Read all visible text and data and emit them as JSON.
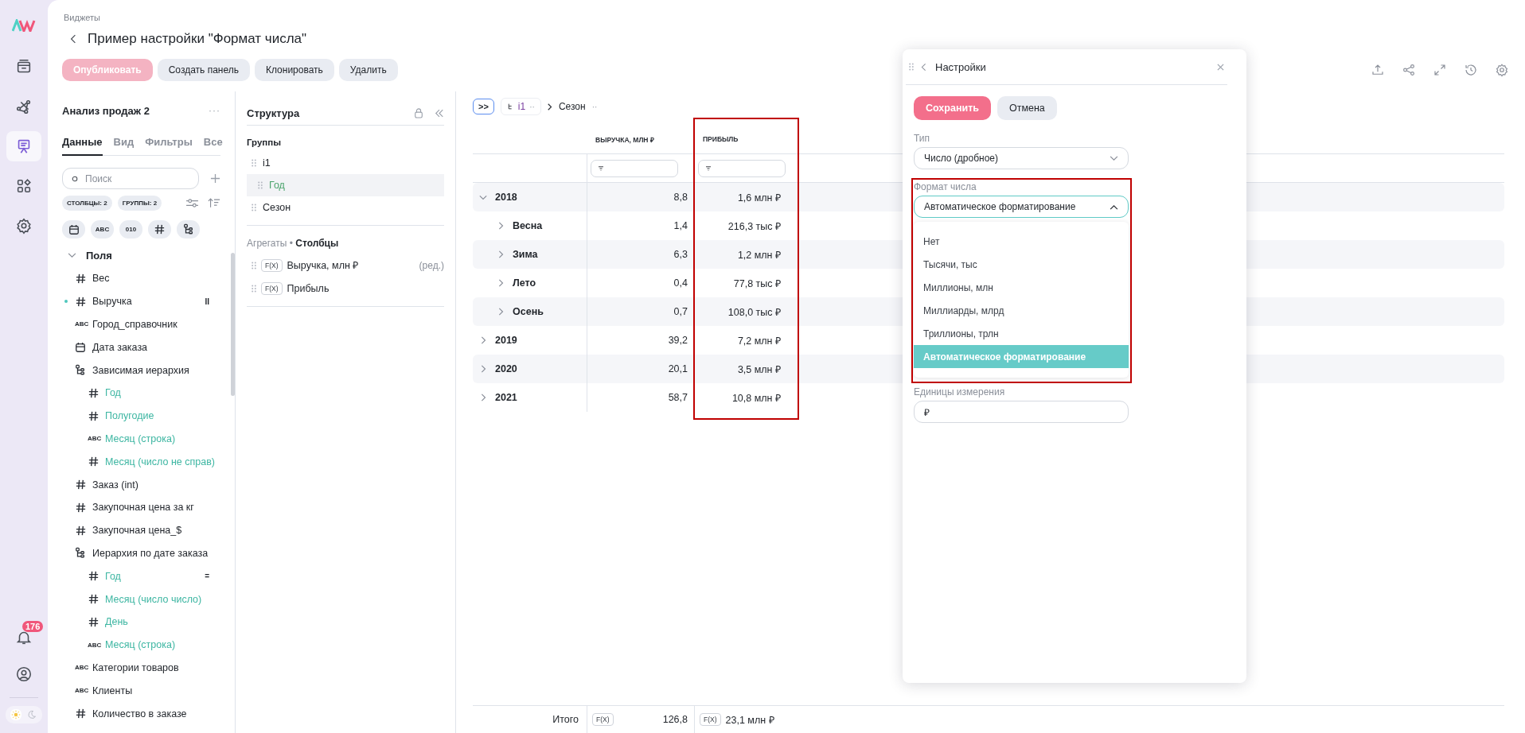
{
  "nav": {
    "items": [
      {
        "kind": "inbox",
        "selected": false
      },
      {
        "kind": "graph",
        "selected": false
      },
      {
        "kind": "presentation",
        "selected": true
      },
      {
        "kind": "grid",
        "selected": false
      },
      {
        "kind": "gear",
        "selected": false
      }
    ],
    "notifications": {
      "badge": "176"
    },
    "theme_options": [
      {
        "kind": "light",
        "selected": true
      },
      {
        "kind": "dark",
        "selected": false
      }
    ]
  },
  "header": {
    "breadcrumb": "Виджеты",
    "title": "Пример настройки \"Формат числа\"",
    "buttons": [
      {
        "label": "Опубликовать",
        "disabled": true
      },
      {
        "label": "Создать панель",
        "disabled": false
      },
      {
        "label": "Клонировать",
        "disabled": false
      },
      {
        "label": "Удалить",
        "disabled": false
      }
    ]
  },
  "dataset": {
    "title": "Анализ продаж 2",
    "more": "···",
    "tabs": [
      {
        "label": "Данные",
        "selected": true
      },
      {
        "label": "Вид",
        "selected": false
      },
      {
        "label": "Фильтры",
        "selected": false
      },
      {
        "label": "Все",
        "selected": false
      }
    ],
    "search": {
      "placeholder": "Поиск"
    },
    "chips": [
      "СТОЛБЦЫ: 2",
      "ГРУППЫ: 2"
    ],
    "type_filters": [
      {
        "kind": "calendar"
      },
      {
        "kind": "text",
        "label": "ABC"
      },
      {
        "kind": "text",
        "label": "010"
      },
      {
        "kind": "number"
      },
      {
        "kind": "hierarchy"
      }
    ],
    "section": {
      "label": "Поля",
      "expanded": true
    },
    "fields": [
      {
        "kind": "number",
        "name": "Вес",
        "active": false
      },
      {
        "kind": "number",
        "name": "Выручка",
        "active": true,
        "marker": "II"
      },
      {
        "kind": "text",
        "badge": "ABC",
        "name": "Город_справочник",
        "active": false
      },
      {
        "kind": "date",
        "name": "Дата заказа",
        "active": false
      },
      {
        "kind": "hierarchy",
        "name": "Зависимая иерархия",
        "active": false,
        "children": [
          {
            "kind": "number",
            "name": "Год"
          },
          {
            "kind": "number",
            "name": "Полугодие"
          },
          {
            "kind": "text",
            "badge": "ABC",
            "name": "Месяц (строка)"
          },
          {
            "kind": "number",
            "name": "Месяц (число не справ)"
          }
        ]
      },
      {
        "kind": "number",
        "name": "Заказ (int)",
        "active": false
      },
      {
        "kind": "number",
        "name": "Закупочная цена за кг",
        "active": false
      },
      {
        "kind": "number",
        "name": "Закупочная цена_$",
        "active": false
      },
      {
        "kind": "hierarchy",
        "name": "Иерархия по дате заказа",
        "active": false,
        "children": [
          {
            "kind": "number",
            "name": "Год",
            "marker": "="
          },
          {
            "kind": "number",
            "name": "Месяц (число число)"
          },
          {
            "kind": "number",
            "name": "День"
          },
          {
            "kind": "text",
            "badge": "ABC",
            "name": "Месяц (строка)"
          }
        ]
      },
      {
        "kind": "text",
        "badge": "ABC",
        "name": "Категории товаров",
        "active": false
      },
      {
        "kind": "text",
        "badge": "ABC",
        "name": "Клиенты",
        "active": false
      },
      {
        "kind": "number",
        "name": "Количество в заказе",
        "active": false
      }
    ]
  },
  "structure": {
    "title": "Структура",
    "groups_label": "Группы",
    "groups": [
      {
        "name": "i1",
        "selected": false,
        "children": [
          {
            "name": "Год",
            "selected": true
          }
        ]
      },
      {
        "name": "Сезон",
        "selected": false
      }
    ],
    "aggregates_label": "Агрегаты • **Столбцы**",
    "aggregates": [
      {
        "badge": "F(X)",
        "name": "Выручка, млн ₽",
        "note": "(ред.)"
      },
      {
        "badge": "F(X)",
        "name": "Прибыль"
      }
    ]
  },
  "table": {
    "toolbar": {
      "expand": ">>",
      "chip_label": "i1",
      "chip_more": "··",
      "next": "Сезон",
      "next_more": "··"
    },
    "columns": [
      {
        "label": "ВЫРУЧКА, МЛН ₽",
        "highlighted": false
      },
      {
        "label": "ПРИБЫЛЬ",
        "highlighted": true
      }
    ],
    "rows": [
      {
        "label": "2018",
        "expanded": true,
        "values": [
          "8,8",
          "1,6 млн ₽"
        ],
        "children": [
          {
            "label": "Весна",
            "expanded": false,
            "values": [
              "1,4",
              "216,3 тыс ₽"
            ]
          },
          {
            "label": "Зима",
            "expanded": false,
            "values": [
              "6,3",
              "1,2 млн ₽"
            ]
          },
          {
            "label": "Лето",
            "expanded": false,
            "values": [
              "0,4",
              "77,8 тыс ₽"
            ]
          },
          {
            "label": "Осень",
            "expanded": false,
            "values": [
              "0,7",
              "108,0 тыс ₽"
            ]
          }
        ]
      },
      {
        "label": "2019",
        "expanded": false,
        "values": [
          "39,2",
          "7,2 млн ₽"
        ]
      },
      {
        "label": "2020",
        "expanded": false,
        "values": [
          "20,1",
          "3,5 млн ₽"
        ]
      },
      {
        "label": "2021",
        "expanded": false,
        "values": [
          "58,7",
          "10,8 млн ₽"
        ]
      }
    ],
    "total": {
      "label": "Итого",
      "cells": [
        {
          "badge": "F(X)",
          "value": "126,8"
        },
        {
          "badge": "F(X)",
          "value": "23,1 млн ₽"
        }
      ]
    }
  },
  "settings": {
    "title": "Настройки",
    "buttons": [
      {
        "label": "Сохранить",
        "kind": "primary"
      },
      {
        "label": "Отмена",
        "kind": "secondary"
      }
    ],
    "type_field": {
      "label": "Тип",
      "value": "Число (дробное)",
      "open": false
    },
    "format_field": {
      "label": "Формат числа",
      "value": "Автоматическое форматирование",
      "open": true,
      "highlighted": true,
      "options": [
        {
          "label": "Нет",
          "selected": false
        },
        {
          "label": "Тысячи, тыс",
          "selected": false
        },
        {
          "label": "Миллионы, млн",
          "selected": false
        },
        {
          "label": "Миллиарды, млрд",
          "selected": false
        },
        {
          "label": "Триллионы, трлн",
          "selected": false
        },
        {
          "label": "Автоматическое форматирование",
          "selected": true
        }
      ]
    },
    "units_field": {
      "label": "Единицы измерения",
      "value": "₽"
    }
  }
}
